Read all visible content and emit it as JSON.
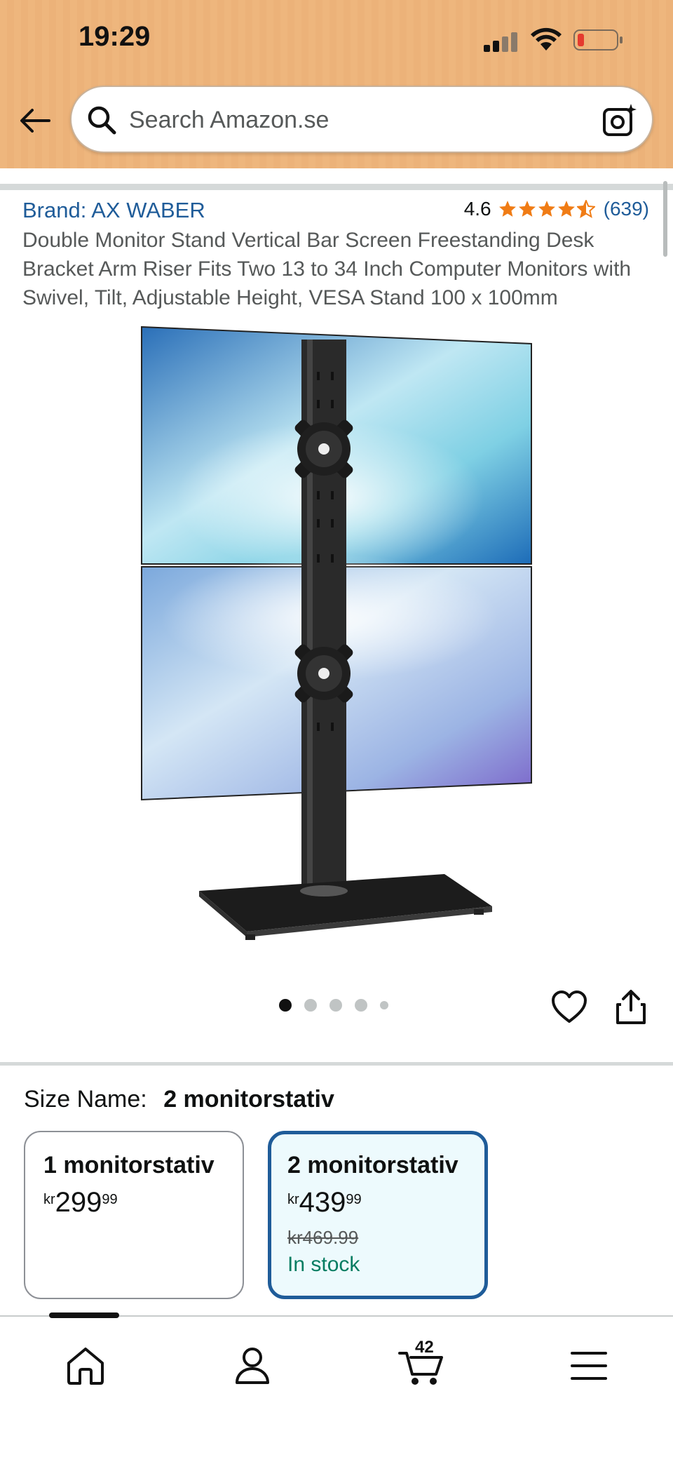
{
  "status_bar": {
    "time": "19:29"
  },
  "search": {
    "placeholder": "Search Amazon.se"
  },
  "product": {
    "brand": "Brand: AX WABER",
    "rating": "4.6",
    "review_count": "(639)",
    "title": "Double Monitor Stand Vertical Bar Screen Freestanding Desk Bracket Arm Riser Fits Two 13 to 34 Inch Computer Monitors with Swivel, Tilt, Adjustable Height, VESA Stand 100 x 100mm"
  },
  "carousel": {
    "image_count": 5,
    "active_index": 0
  },
  "size": {
    "label": "Size Name:",
    "selected": "2 monitorstativ",
    "options": [
      {
        "name": "1 monitorstativ",
        "currency": "kr",
        "price_whole": "299",
        "price_fraction": "99"
      },
      {
        "name": "2 monitorstativ",
        "currency": "kr",
        "price_whole": "439",
        "price_fraction": "99",
        "old_price": "kr469.99",
        "stock": "In stock"
      }
    ]
  },
  "nav": {
    "cart_count": "42"
  },
  "colors": {
    "header": "#eeb67d",
    "link": "#1f5c99",
    "star": "#f07c15",
    "stock": "#067d62",
    "selected_border": "#1f5c99"
  }
}
